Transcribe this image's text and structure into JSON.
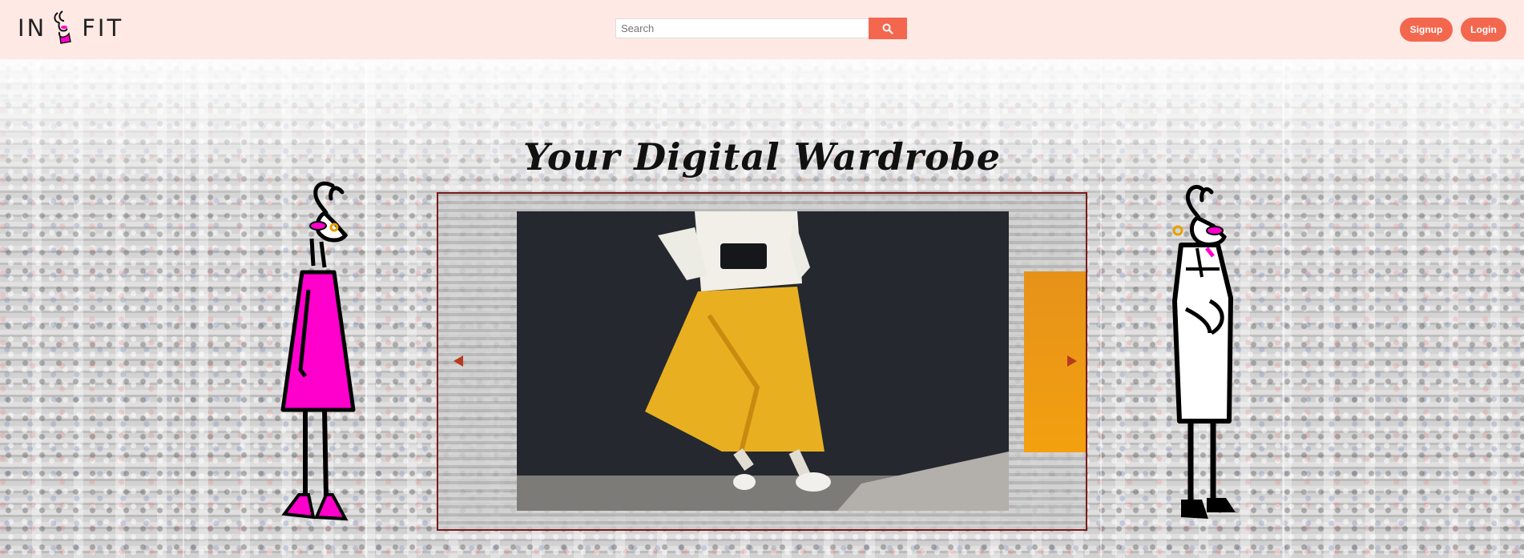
{
  "header": {
    "logo_text_left": "IN",
    "logo_text_right": "FIT",
    "search": {
      "placeholder": "Search",
      "value": "",
      "icon": "search-icon"
    },
    "signup_label": "Signup",
    "login_label": "Login"
  },
  "hero": {
    "title": "Your Digital Wardrobe"
  },
  "carousel": {
    "prev_icon": "caret-left-icon",
    "next_icon": "caret-right-icon"
  },
  "colors": {
    "header_bg": "#ffe9e4",
    "accent": "#f4674f",
    "carousel_border": "#7a1a1a",
    "arrow": "#b83a1e",
    "skirt_yellow": "#e8b020",
    "dress_magenta": "#ff00cc",
    "next_slide_orange": "#f3a010"
  }
}
